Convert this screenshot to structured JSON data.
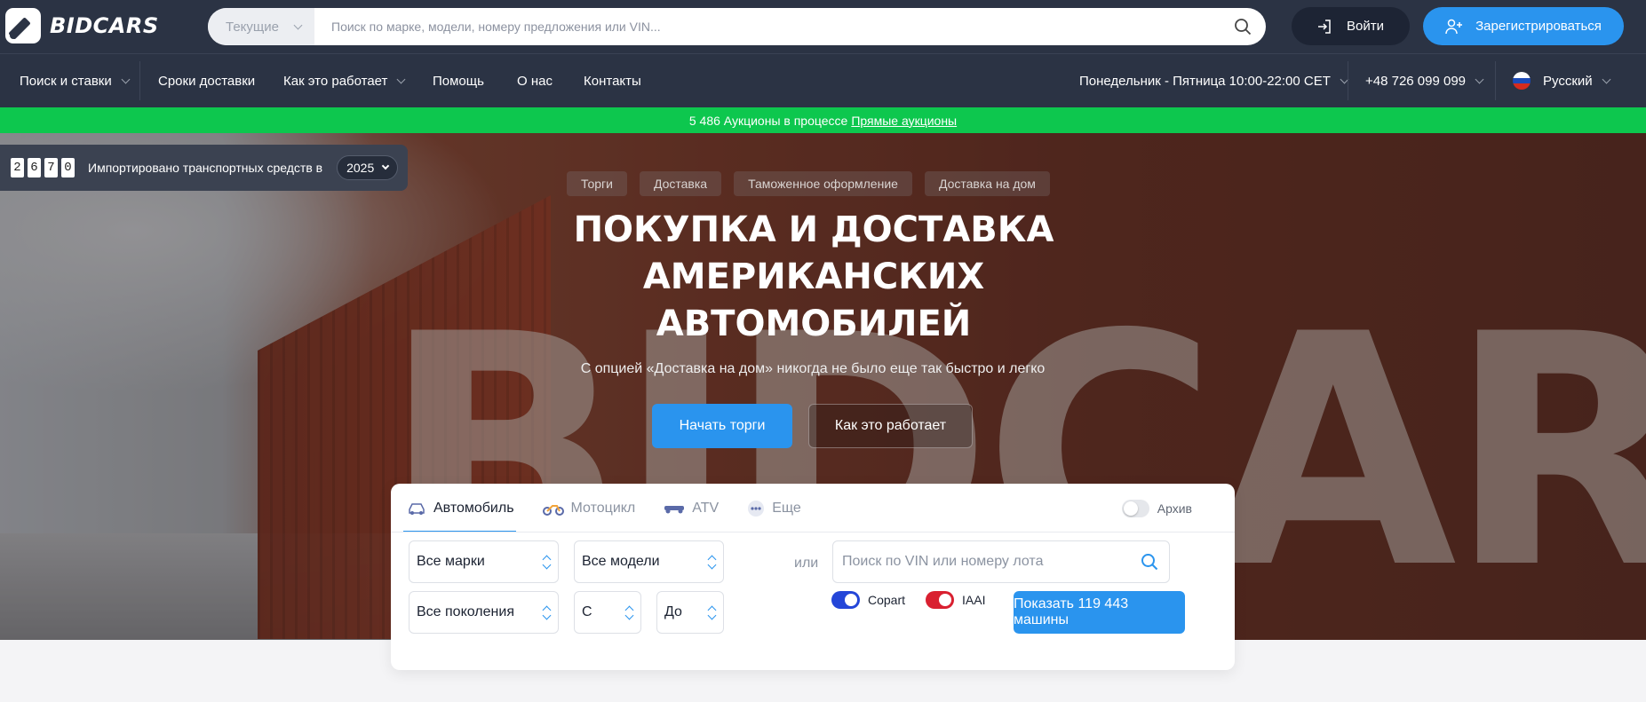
{
  "brand": {
    "name": "BIDCARS"
  },
  "search": {
    "scope": "Текущие",
    "placeholder": "Поиск по марке, модели, номеру предложения или VIN..."
  },
  "auth": {
    "login": "Войти",
    "register": "Зарегистрироваться"
  },
  "nav": {
    "items": [
      {
        "label": "Поиск и ставки",
        "dropdown": true
      },
      {
        "label": "Сроки доставки",
        "dropdown": false
      },
      {
        "label": "Как это работает",
        "dropdown": true
      },
      {
        "label": "Помощь",
        "dropdown": false
      },
      {
        "label": "О нас",
        "dropdown": false
      },
      {
        "label": "Контакты",
        "dropdown": false
      }
    ],
    "hours": "Понедельник - Пятница 10:00-22:00 CET",
    "phone": "+48 726 099 099",
    "language": "Русский"
  },
  "live_bar": {
    "text": "5 486 Аукционы в процессе",
    "link": "Прямые аукционы"
  },
  "counter": {
    "digits": [
      "2",
      "6",
      "7",
      "0"
    ],
    "label": "Импортировано транспортных средств в",
    "year": "2025"
  },
  "hero": {
    "tags": [
      "Торги",
      "Доставка",
      "Таможенное оформление",
      "Доставка на дом"
    ],
    "title": "ПОКУПКА И ДОСТАВКА АМЕРИКАНСКИХ АВТОМОБИЛЕЙ",
    "subtitle": "С опцией «Доставка на дом» никогда не было еще так быстро и легко",
    "cta_primary": "Начать торги",
    "cta_secondary": "Как это работает",
    "watermark": "BIDCARS"
  },
  "finder": {
    "tabs": [
      {
        "label": "Автомобиль",
        "icon": "car-icon",
        "active": true
      },
      {
        "label": "Мотоцикл",
        "icon": "motorcycle-icon",
        "active": false
      },
      {
        "label": "ATV",
        "icon": "atv-icon",
        "active": false
      },
      {
        "label": "Еще",
        "icon": "more-icon",
        "active": false
      }
    ],
    "archive_label": "Архив",
    "make": "Все марки",
    "model": "Все модели",
    "or": "или",
    "vin_placeholder": "Поиск по VIN или номеру лота",
    "generation": "Все поколения",
    "year_from": "С",
    "year_to": "До",
    "auctions": [
      {
        "label": "Copart",
        "color": "#2446d8",
        "enabled": true
      },
      {
        "label": "IAAI",
        "color": "#d92030",
        "enabled": true
      }
    ],
    "show_button": "Показать 119 443 машины"
  },
  "colors": {
    "accent": "#2a94ee",
    "header": "#2b3344",
    "live": "#0dc74e"
  }
}
